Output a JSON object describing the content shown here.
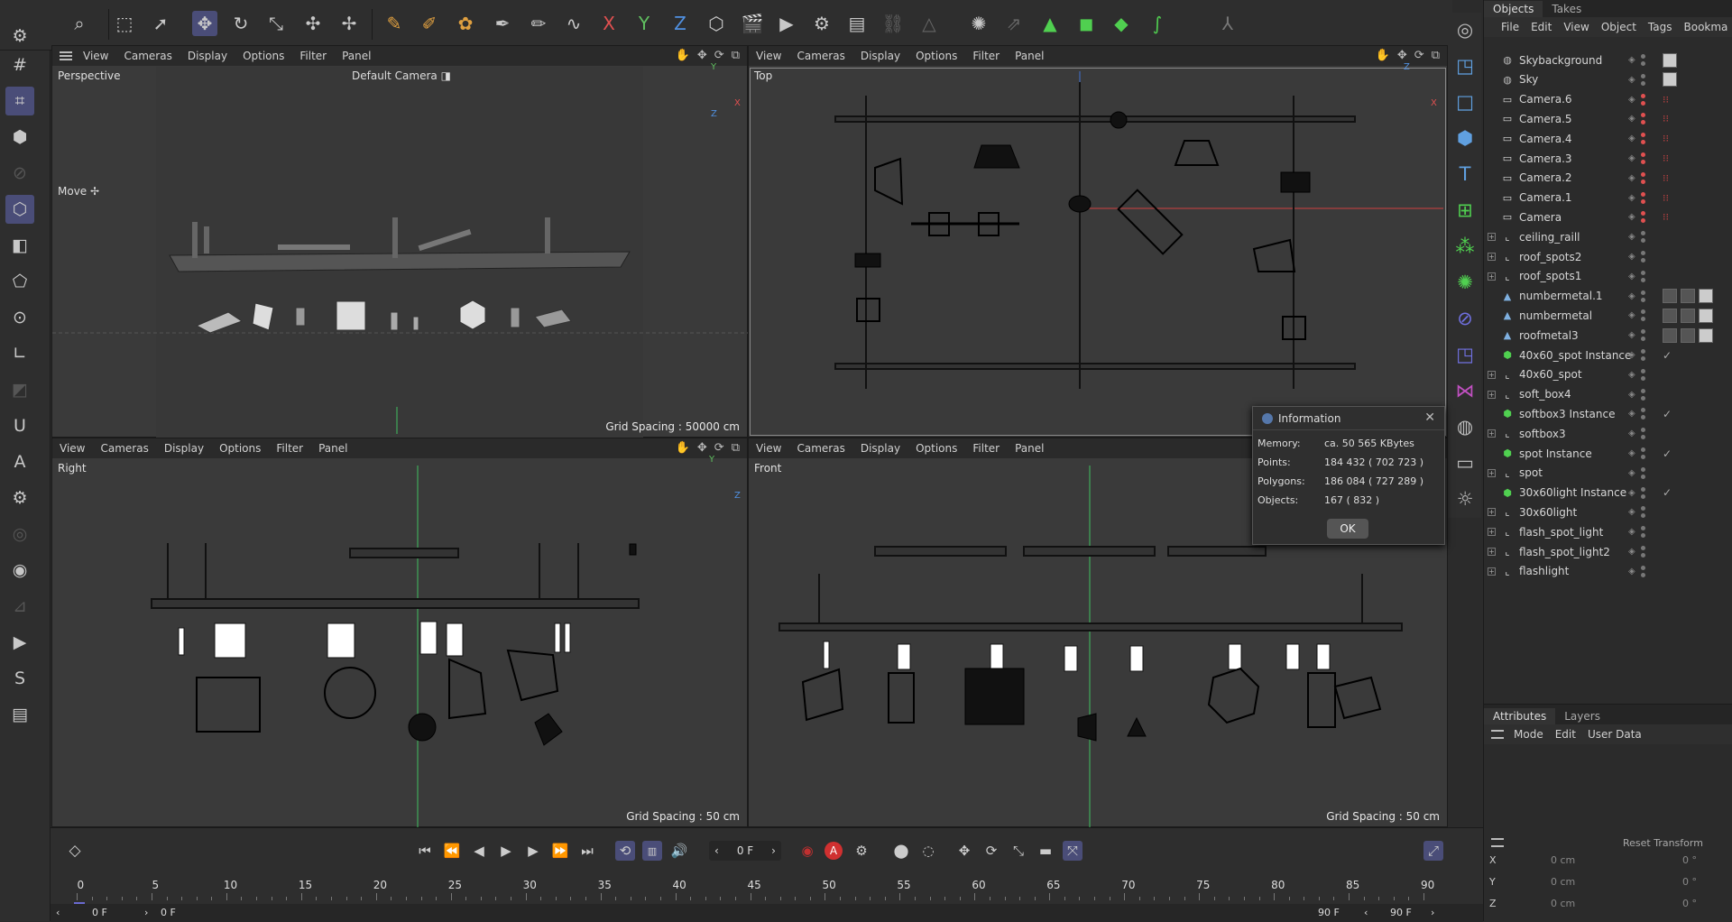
{
  "top_toolbar": {
    "icons": [
      "search-icon",
      "live-selection-icon",
      "select-arrow-icon",
      "move-icon",
      "rotate-icon",
      "scale-icon",
      "transform-icon",
      "axis-icon",
      "spline-pen-icon",
      "spline-brush-icon",
      "spline-tools-icon",
      "paint-brush-icon",
      "sketch-icon",
      "spline-smooth-icon",
      "x-axis-icon",
      "y-axis-icon",
      "z-axis-icon",
      "coordinate-system-icon",
      "render-view-icon",
      "render-active-icon",
      "render-settings-icon",
      "render-queue-icon",
      "link-icon",
      "deformer-icon",
      "generator-icon",
      "emitter-icon",
      "mograph-cloner-icon",
      "subdivision-icon",
      "cube-primitive-icon",
      "sweep-icon",
      "character-icon"
    ],
    "x_label": "X",
    "y_label": "Y",
    "z_label": "Z"
  },
  "viewports": {
    "menu": [
      "View",
      "Cameras",
      "Display",
      "Options",
      "Filter",
      "Panel"
    ],
    "perspective": {
      "label": "Perspective",
      "camera": "Default Camera",
      "tool": "Move",
      "grid": "Grid Spacing : 50000 cm"
    },
    "top": {
      "label": "Top",
      "grid": ""
    },
    "right": {
      "label": "Right",
      "grid": "Grid Spacing : 50 cm"
    },
    "front": {
      "label": "Front",
      "grid": "Grid Spacing : 50 cm"
    },
    "axis": {
      "x": "X",
      "y": "Y",
      "z": "Z"
    }
  },
  "object_manager": {
    "tabs": [
      "Objects",
      "Takes"
    ],
    "menu": [
      "File",
      "Edit",
      "View",
      "Object",
      "Tags",
      "Bookma"
    ],
    "objects": [
      {
        "name": "Skybackground",
        "icon": "globe-icon",
        "expand": false,
        "cam": false,
        "tags": 1
      },
      {
        "name": "Sky",
        "icon": "globe-icon",
        "expand": false,
        "cam": false,
        "tags": 1
      },
      {
        "name": "Camera.6",
        "icon": "camera-icon",
        "expand": false,
        "cam": true,
        "tags": 0
      },
      {
        "name": "Camera.5",
        "icon": "camera-icon",
        "expand": false,
        "cam": true,
        "tags": 0
      },
      {
        "name": "Camera.4",
        "icon": "camera-icon",
        "expand": false,
        "cam": true,
        "tags": 0
      },
      {
        "name": "Camera.3",
        "icon": "camera-icon",
        "expand": false,
        "cam": true,
        "tags": 0
      },
      {
        "name": "Camera.2",
        "icon": "camera-icon",
        "expand": false,
        "cam": true,
        "tags": 0
      },
      {
        "name": "Camera.1",
        "icon": "camera-icon",
        "expand": false,
        "cam": true,
        "tags": 0
      },
      {
        "name": "Camera",
        "icon": "camera-icon",
        "expand": false,
        "cam": true,
        "tags": 0
      },
      {
        "name": "ceiling_raill",
        "icon": "null-icon",
        "expand": true,
        "cam": false,
        "tags": 0
      },
      {
        "name": "roof_spots2",
        "icon": "null-icon",
        "expand": true,
        "cam": false,
        "tags": 0
      },
      {
        "name": "roof_spots1",
        "icon": "null-icon",
        "expand": true,
        "cam": false,
        "tags": 0
      },
      {
        "name": "numbermetal.1",
        "icon": "polygon-icon",
        "expand": false,
        "cam": false,
        "tags": 3
      },
      {
        "name": "numbermetal",
        "icon": "polygon-icon",
        "expand": false,
        "cam": false,
        "tags": 3
      },
      {
        "name": "roofmetal3",
        "icon": "polygon-icon",
        "expand": false,
        "cam": false,
        "tags": 3
      },
      {
        "name": "40x60_spot Instance",
        "icon": "instance-icon",
        "expand": false,
        "cam": false,
        "tags": 0,
        "check": true
      },
      {
        "name": "40x60_spot",
        "icon": "null-icon",
        "expand": true,
        "cam": false,
        "tags": 0
      },
      {
        "name": "soft_box4",
        "icon": "null-icon",
        "expand": true,
        "cam": false,
        "tags": 0
      },
      {
        "name": "softbox3 Instance",
        "icon": "instance-icon",
        "expand": false,
        "cam": false,
        "tags": 0,
        "check": true
      },
      {
        "name": "softbox3",
        "icon": "null-icon",
        "expand": true,
        "cam": false,
        "tags": 0
      },
      {
        "name": "spot Instance",
        "icon": "instance-icon",
        "expand": false,
        "cam": false,
        "tags": 0,
        "check": true
      },
      {
        "name": "spot",
        "icon": "null-icon",
        "expand": true,
        "cam": false,
        "tags": 0
      },
      {
        "name": "30x60light Instance",
        "icon": "instance-icon",
        "expand": false,
        "cam": false,
        "tags": 0,
        "check": true
      },
      {
        "name": "30x60light",
        "icon": "null-icon",
        "expand": true,
        "cam": false,
        "tags": 0
      },
      {
        "name": "flash_spot_light",
        "icon": "null-icon",
        "expand": true,
        "cam": false,
        "tags": 0
      },
      {
        "name": "flash_spot_light2",
        "icon": "null-icon",
        "expand": true,
        "cam": false,
        "tags": 0
      },
      {
        "name": "flashlight",
        "icon": "null-icon",
        "expand": true,
        "cam": false,
        "tags": 0
      }
    ]
  },
  "attributes": {
    "tabs": [
      "Attributes",
      "Layers"
    ],
    "menu": [
      "Mode",
      "Edit",
      "User Data"
    ],
    "reset_label": "Reset Transform",
    "rows": [
      {
        "axis": "X",
        "val1": "0 cm",
        "val2": "0 °"
      },
      {
        "axis": "Y",
        "val1": "0 cm",
        "val2": "0 °"
      },
      {
        "axis": "Z",
        "val1": "0 cm",
        "val2": "0 °"
      }
    ]
  },
  "info_dialog": {
    "title": "Information",
    "memory_label": "Memory:",
    "memory": "ca. 50 565 KBytes",
    "points_label": "Points:",
    "points": "184 432 ( 702 723 )",
    "polygons_label": "Polygons:",
    "polygons": "186 084 ( 727 289 )",
    "objects_label": "Objects:",
    "objects": "167 ( 832 )",
    "ok": "OK"
  },
  "timeline": {
    "current_frame": "0 F",
    "start_field": "0 F",
    "start_field2": "0 F",
    "end_field": "90 F",
    "end_field2": "90 F",
    "ruler": [
      "0",
      "5",
      "10",
      "15",
      "20",
      "25",
      "30",
      "35",
      "40",
      "45",
      "50",
      "55",
      "60",
      "65",
      "70",
      "75",
      "80",
      "85",
      "90"
    ],
    "record_label": "A"
  },
  "colors": {
    "accent": "#4a4d78",
    "x_axis": "#e04040",
    "y_axis": "#40c040",
    "z_axis": "#4080e0",
    "playhead": "#6a6ad0"
  }
}
